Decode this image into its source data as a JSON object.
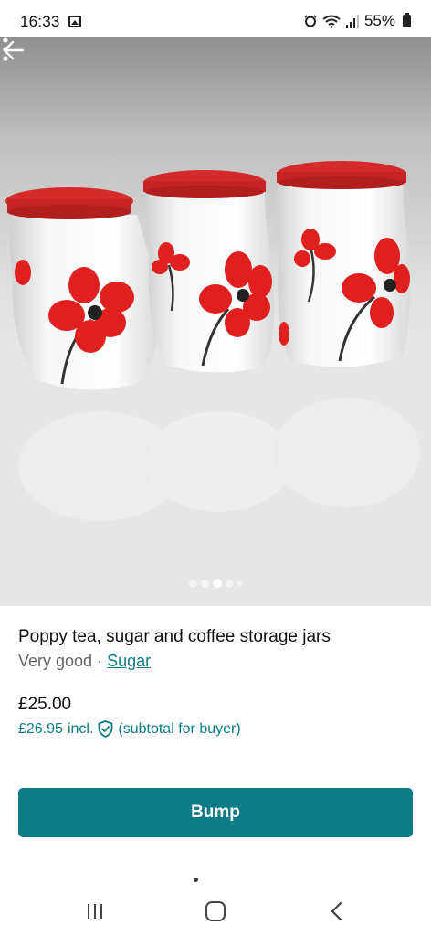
{
  "status_bar": {
    "time": "16:33",
    "battery": "55%",
    "icons": [
      "gallery-icon",
      "alarm-icon",
      "wifi-icon",
      "signal-icon",
      "battery-icon"
    ]
  },
  "photo": {
    "image_count": 5,
    "active_index": 2,
    "icons": [
      "back-arrow-icon",
      "more-vertical-icon"
    ]
  },
  "listing": {
    "title": "Poppy tea, sugar and coffee storage jars",
    "condition": "Very good",
    "separator": " · ",
    "brand": "Sugar",
    "price": "£25.00",
    "buyer_price": "£26.95",
    "buyer_incl": "incl.",
    "buyer_note": "(subtotal for buyer)"
  },
  "actions": {
    "bump_label": "Bump"
  },
  "colors": {
    "accent": "#0f7c85",
    "lid_red": "#d42a2a"
  }
}
